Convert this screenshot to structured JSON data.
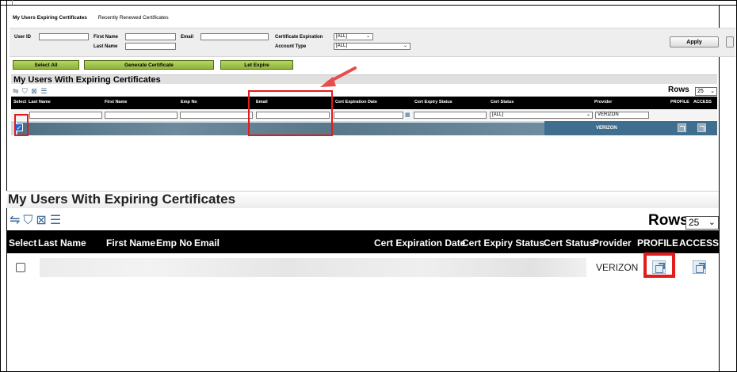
{
  "tabs": [
    {
      "label": "My Users Expiring Certificates",
      "active": true
    },
    {
      "label": "Recently Renewed Certificates",
      "active": false
    }
  ],
  "filters": {
    "user_id_label": "User ID",
    "first_name_label": "First Name",
    "last_name_label": "Last Name",
    "email_label": "Email",
    "cert_expiration_label": "Certificate Expiration",
    "cert_expiration_value": "[ALL]",
    "account_type_label": "Account Type",
    "account_type_value": "[ALL]",
    "apply_label": "Apply"
  },
  "actions": {
    "select_all": "Select All",
    "generate_certificate": "Generate Certificate",
    "let_expire": "Let Expire"
  },
  "small_grid": {
    "title": "My Users With Expiring Certificates",
    "tool_icons": "⇋ ⛉ ⊠ ☰",
    "rows_label": "Rows",
    "rows_value": "25",
    "columns": [
      "Select",
      "Last Name",
      "First Name",
      "Emp No",
      "Email",
      "Cert Expiration Date",
      "Cert Expiry Status",
      "Cert Status",
      "Provider",
      "PROFILE",
      "ACCESS"
    ],
    "cert_status_filter": "[ALL]",
    "provider_filter": "VERIZON",
    "row_provider": "VERIZON"
  },
  "large_grid": {
    "title": "My Users With Expiring Certificates",
    "tool_icons": "⇋⛉⊠☰",
    "rows_label": "Rows",
    "rows_value": "25",
    "columns": [
      "Select",
      "Last Name",
      "First Name",
      "Emp No",
      "Email",
      "Cert Expiration Date",
      "Cert Expiry Status",
      "Cert Status",
      "Provider",
      "PROFILE",
      "ACCESS"
    ],
    "row_provider": "VERIZON"
  },
  "colors": {
    "highlight": "#e21b1b",
    "action_button": "#9dc14a",
    "selected_row": "#406e8e",
    "header": "#000000"
  }
}
